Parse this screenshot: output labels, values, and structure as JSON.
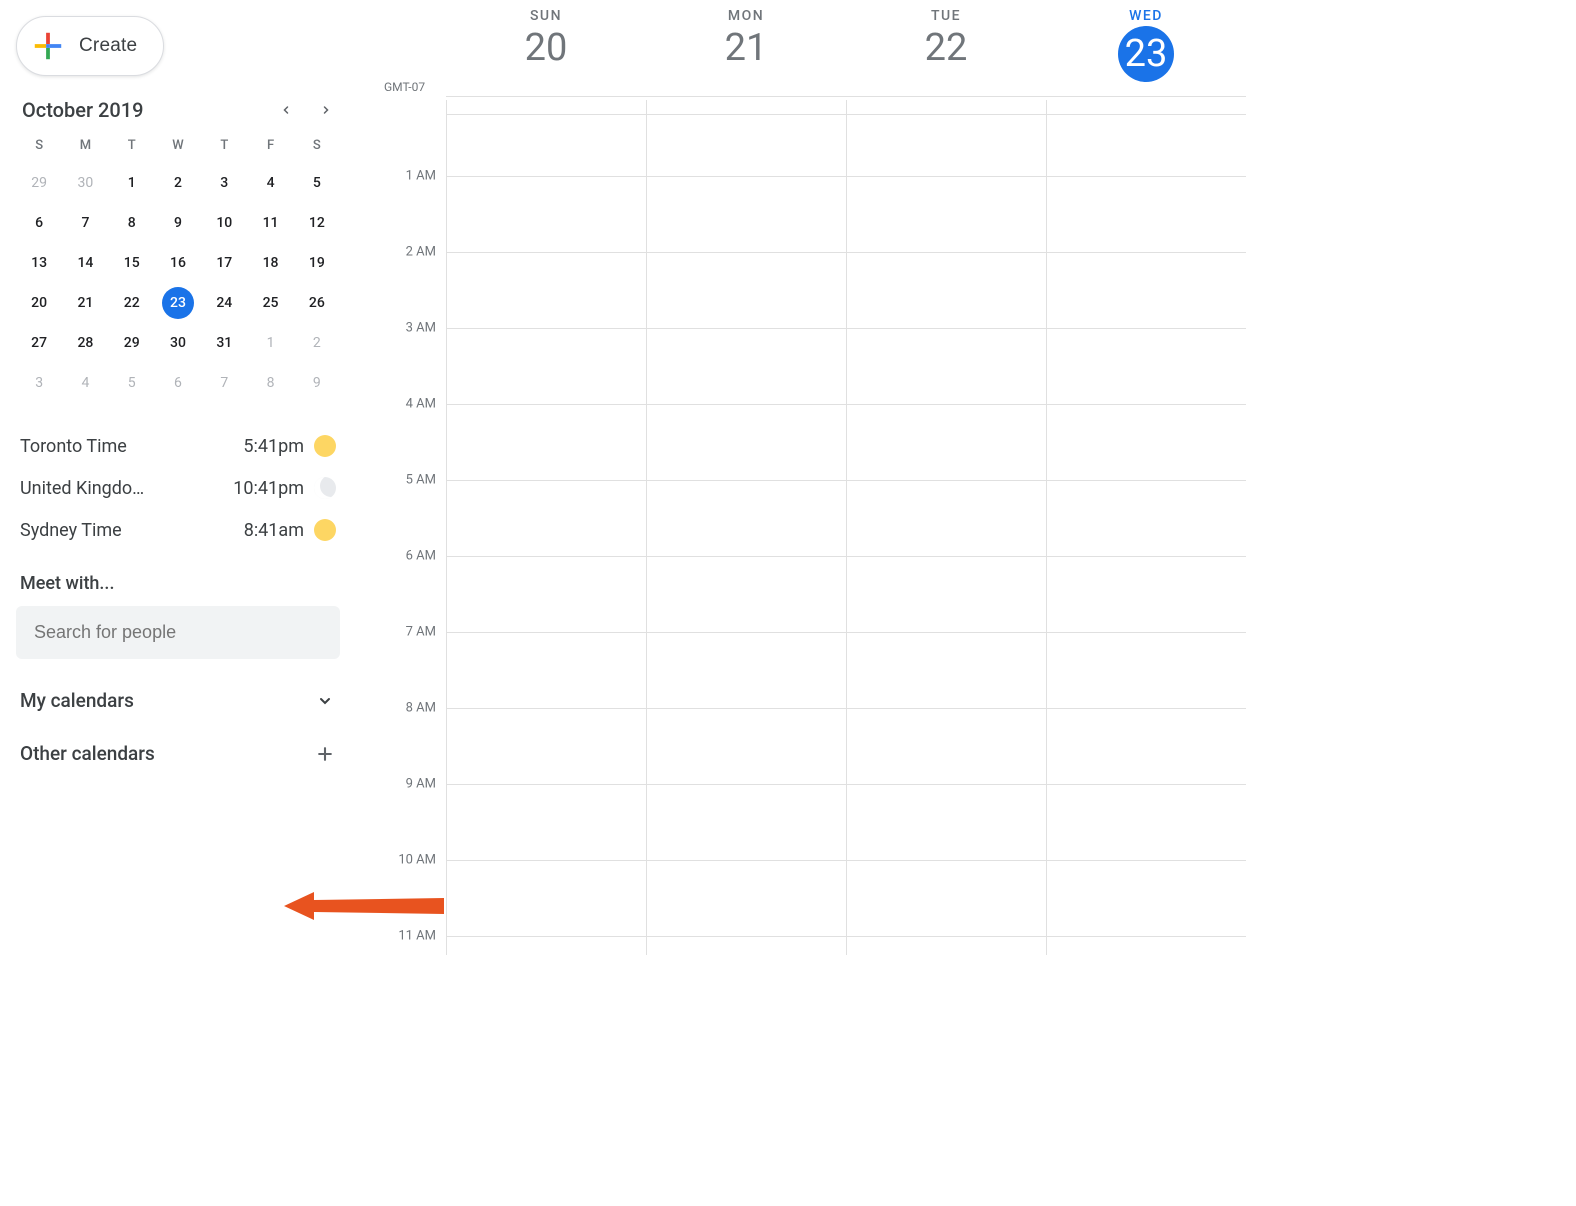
{
  "create_label": "Create",
  "mini": {
    "title": "October 2019",
    "dow": [
      "S",
      "M",
      "T",
      "W",
      "T",
      "F",
      "S"
    ],
    "days": [
      {
        "n": "29",
        "dim": true
      },
      {
        "n": "30",
        "dim": true
      },
      {
        "n": "1"
      },
      {
        "n": "2"
      },
      {
        "n": "3"
      },
      {
        "n": "4"
      },
      {
        "n": "5"
      },
      {
        "n": "6"
      },
      {
        "n": "7"
      },
      {
        "n": "8"
      },
      {
        "n": "9"
      },
      {
        "n": "10"
      },
      {
        "n": "11"
      },
      {
        "n": "12"
      },
      {
        "n": "13"
      },
      {
        "n": "14"
      },
      {
        "n": "15"
      },
      {
        "n": "16"
      },
      {
        "n": "17"
      },
      {
        "n": "18"
      },
      {
        "n": "19"
      },
      {
        "n": "20"
      },
      {
        "n": "21"
      },
      {
        "n": "22"
      },
      {
        "n": "23",
        "today": true
      },
      {
        "n": "24"
      },
      {
        "n": "25"
      },
      {
        "n": "26"
      },
      {
        "n": "27"
      },
      {
        "n": "28"
      },
      {
        "n": "29"
      },
      {
        "n": "30"
      },
      {
        "n": "31"
      },
      {
        "n": "1",
        "dim": true
      },
      {
        "n": "2",
        "dim": true
      },
      {
        "n": "3",
        "dim": true
      },
      {
        "n": "4",
        "dim": true
      },
      {
        "n": "5",
        "dim": true
      },
      {
        "n": "6",
        "dim": true
      },
      {
        "n": "7",
        "dim": true
      },
      {
        "n": "8",
        "dim": true
      },
      {
        "n": "9",
        "dim": true
      }
    ]
  },
  "clocks": [
    {
      "label": "Toronto Time",
      "time": "5:41pm",
      "icon": "sun"
    },
    {
      "label": "United Kingdo…",
      "time": "10:41pm",
      "icon": "moon"
    },
    {
      "label": "Sydney Time",
      "time": "8:41am",
      "icon": "sun"
    }
  ],
  "meet_with_label": "Meet with...",
  "search_placeholder": "Search for people",
  "my_calendars_label": "My calendars",
  "other_calendars_label": "Other calendars",
  "timezone": "GMT-07",
  "week_days": [
    {
      "dow": "SUN",
      "num": "20",
      "active": false
    },
    {
      "dow": "MON",
      "num": "21",
      "active": false
    },
    {
      "dow": "TUE",
      "num": "22",
      "active": false
    },
    {
      "dow": "WED",
      "num": "23",
      "active": true
    }
  ],
  "hours": [
    "1 AM",
    "2 AM",
    "3 AM",
    "4 AM",
    "5 AM",
    "6 AM",
    "7 AM",
    "8 AM",
    "9 AM",
    "10 AM",
    "11 AM"
  ]
}
